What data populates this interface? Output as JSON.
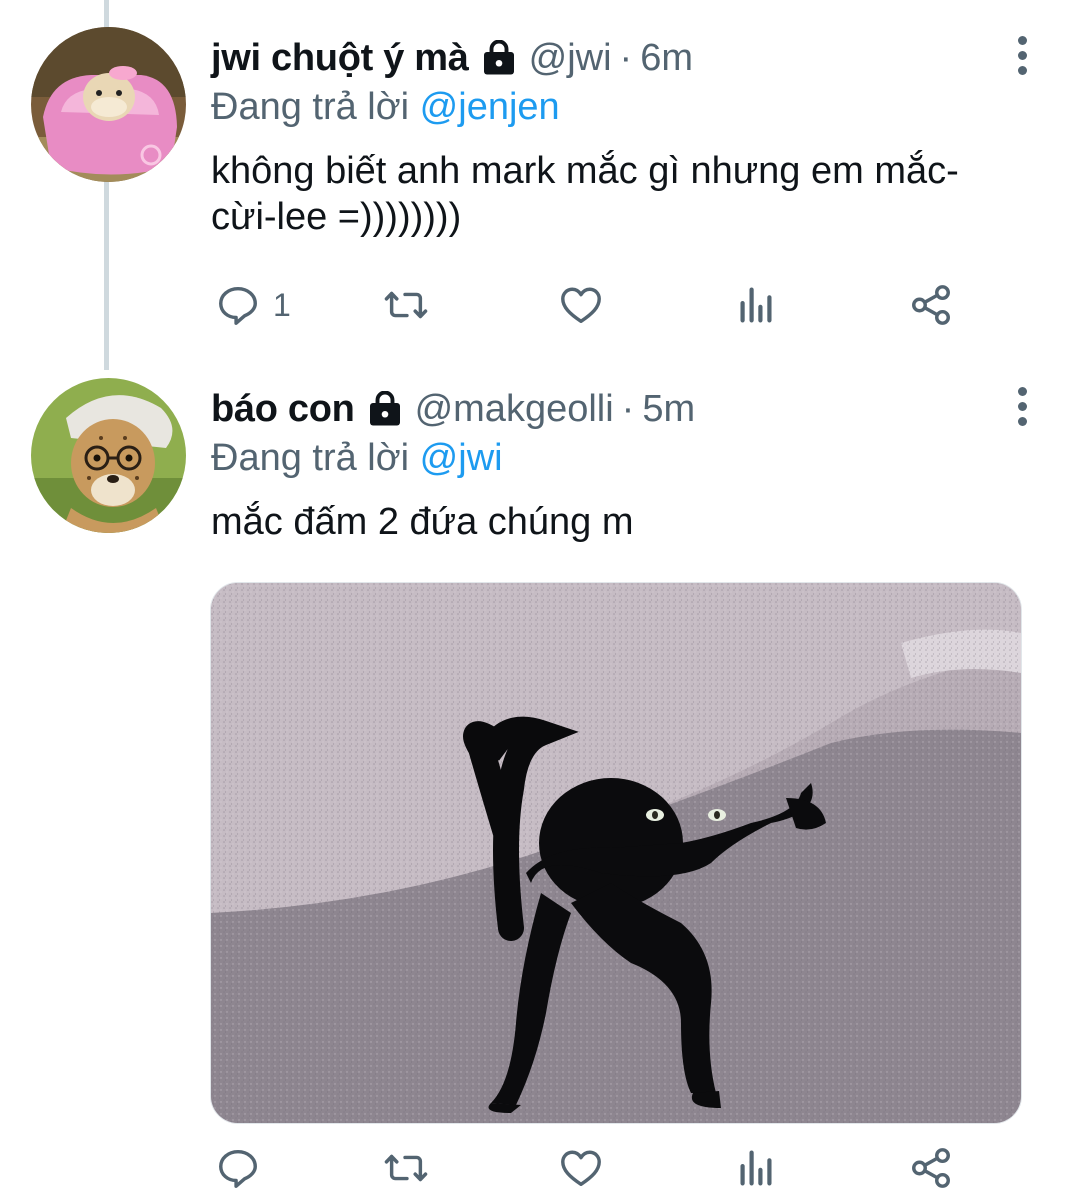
{
  "tweets": [
    {
      "display_name": "jwi chuột ý mà",
      "handle": "@jwi",
      "time": "6m",
      "replying_prefix": "Đang trả lời",
      "replying_to": "@jenjen",
      "text_line1": "không biết anh mark mắc gì nhưng em mắc-",
      "text_line2": "cừi-lee =))))))))",
      "reply_count": "1",
      "avatar_desc": "hamster-in-pink-car"
    },
    {
      "display_name": "báo con",
      "handle": "@makgeolli",
      "time": "5m",
      "replying_prefix": "Đang trả lời",
      "replying_to": "@jwi",
      "text_line1": "mắc đấm 2 đứa chúng m",
      "avatar_desc": "cheetah-cub-with-glasses",
      "media_desc": "black-cat-meme-photo"
    }
  ],
  "icons": {
    "reply": "reply-icon",
    "retweet": "retweet-icon",
    "like": "heart-icon",
    "analytics": "analytics-icon",
    "share": "share-icon",
    "more": "more-vertical-icon",
    "lock": "lock-icon"
  },
  "colors": {
    "text": "#0f1419",
    "secondary": "#536471",
    "link": "#1d9bf0",
    "thread_line": "#cfd9de"
  }
}
